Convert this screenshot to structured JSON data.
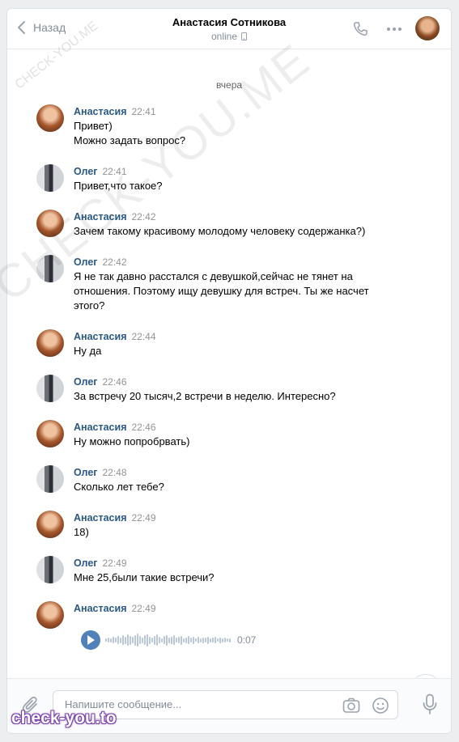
{
  "header": {
    "back_label": "Назад",
    "peer_name": "Анастасия Сотникова",
    "peer_status": "online"
  },
  "history": {
    "day_label": "вчера",
    "messages": [
      {
        "author": "Анастасия",
        "time": "22:41",
        "text": "Привет)\nМожно задать вопрос?"
      },
      {
        "author": "Олег",
        "time": "22:41",
        "text": "Привет,что такое?"
      },
      {
        "author": "Анастасия",
        "time": "22:42",
        "text": "Зачем такому красивому молодому человеку содержанка?)"
      },
      {
        "author": "Олег",
        "time": "22:42",
        "text": "Я не так давно расстался с девушкой,сейчас не тянет на отношения. Поэтому ищу девушку для встреч. Ты же насчет этого?"
      },
      {
        "author": "Анастасия",
        "time": "22:44",
        "text": "Ну да"
      },
      {
        "author": "Олег",
        "time": "22:46",
        "text": "За встречу 20 тысяч,2 встречи в неделю. Интересно?"
      },
      {
        "author": "Анастасия",
        "time": "22:46",
        "text": "Ну можно попробрвать)"
      },
      {
        "author": "Олег",
        "time": "22:48",
        "text": "Сколько лет тебе?"
      },
      {
        "author": "Анастасия",
        "time": "22:49",
        "text": "18)"
      },
      {
        "author": "Олег",
        "time": "22:49",
        "text": "Мне 25,были такие встречи?"
      },
      {
        "author": "Анастасия",
        "time": "22:49",
        "text": ""
      }
    ],
    "voice_duration": "0:07"
  },
  "composer": {
    "placeholder": "Напишите сообщение..."
  },
  "watermarks": {
    "diagonal": "CHECK-YOU.ME",
    "small": "CHECK-YOU.ME",
    "bottom": "check-you.to"
  },
  "colors": {
    "accent": "#5181b8",
    "author": "#2a5885",
    "muted": "#818c99"
  }
}
